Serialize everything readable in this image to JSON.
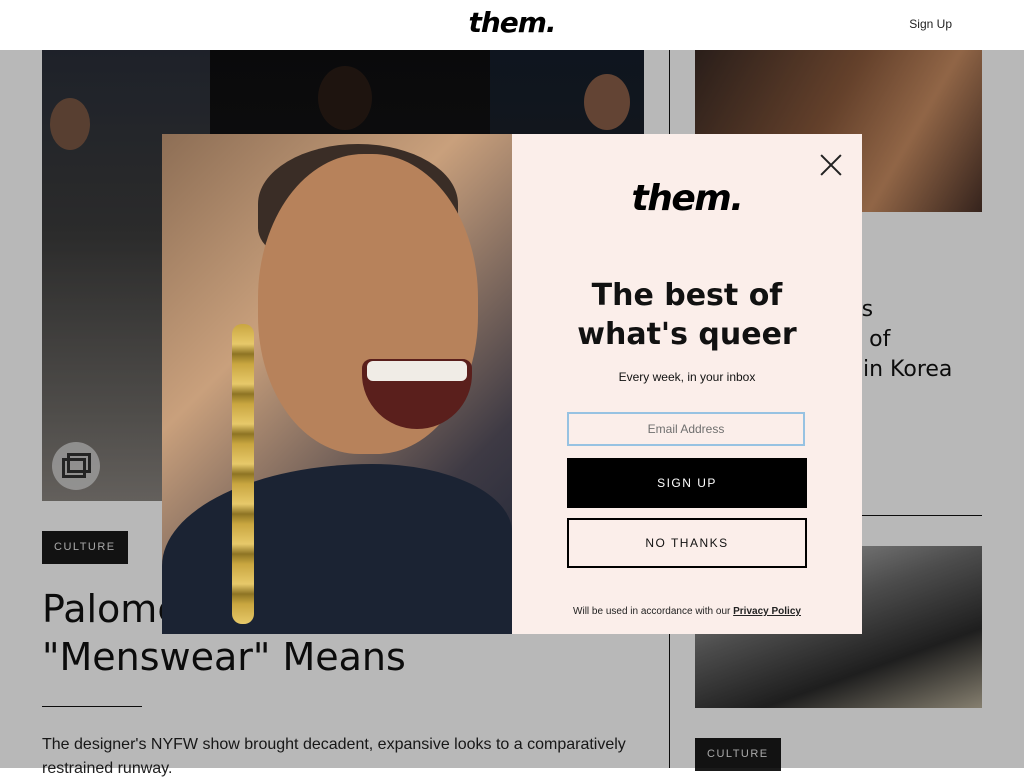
{
  "header": {
    "logo": "them.",
    "signup_label": "Sign Up"
  },
  "main_article": {
    "category": "CULTURE",
    "headline_line1": "Palome",
    "headline_line2": "\"Menswear\" Means",
    "dek": "The designer's NYFW show brought decadent, expansive looks to a comparatively restrained runway."
  },
  "side_article": {
    "headline": "...ian is\n...ace of\n... in Korea"
  },
  "side_article_2": {
    "category": "CULTURE"
  },
  "modal": {
    "logo": "them.",
    "title": "The best of what's queer",
    "subtitle": "Every week, in your inbox",
    "email_placeholder": "Email Address",
    "signup_label": "SIGN UP",
    "no_thanks_label": "NO THANKS",
    "legal_text": "Will be used in accordance with our",
    "privacy_label": "Privacy Policy"
  },
  "colors": {
    "modal_bg": "#fbeeea",
    "input_border": "#97c2e2",
    "button_bg": "#000000",
    "tag_bg": "#1a1a1a"
  },
  "icons": {
    "close": "close-icon",
    "gallery": "gallery-icon"
  }
}
